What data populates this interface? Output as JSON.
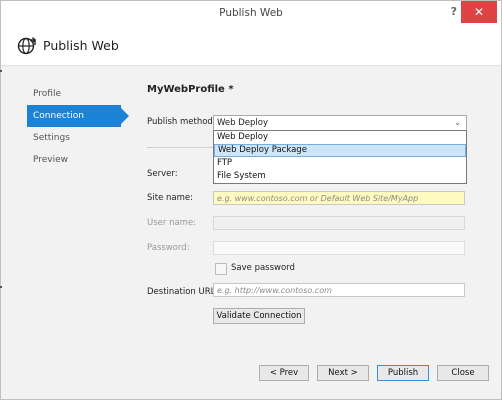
{
  "window": {
    "title": "Publish Web",
    "help_label": "?",
    "close_label": "✕"
  },
  "header": {
    "title": "Publish Web",
    "icon": "globe-icon"
  },
  "nav": {
    "items": [
      {
        "label": "Profile"
      },
      {
        "label": "Connection"
      },
      {
        "label": "Settings"
      },
      {
        "label": "Preview"
      }
    ],
    "active_index": 1
  },
  "main": {
    "profile_title": "MyWebProfile *",
    "publish_method": {
      "label": "Publish method:",
      "value": "Web Deploy",
      "options": [
        "Web Deploy",
        "Web Deploy Package",
        "FTP",
        "File System"
      ],
      "highlighted": "Web Deploy Package"
    },
    "server": {
      "label": "Server:",
      "value": ""
    },
    "site_name": {
      "label": "Site name:",
      "placeholder": "e.g. www.contoso.com or Default Web Site/MyApp"
    },
    "user_name": {
      "label": "User name:",
      "value": ""
    },
    "password": {
      "label": "Password:",
      "value": ""
    },
    "save_password": {
      "label": "Save password",
      "checked": false
    },
    "destination_url": {
      "label": "Destination URL:",
      "placeholder": "e.g. http://www.contoso.com"
    },
    "validate_button": "Validate Connection"
  },
  "footer": {
    "prev": "< Prev",
    "next": "Next >",
    "publish": "Publish",
    "close": "Close"
  },
  "colors": {
    "accent": "#1c82d6",
    "close_button": "#e04343",
    "site_highlight": "#fffbc0"
  }
}
